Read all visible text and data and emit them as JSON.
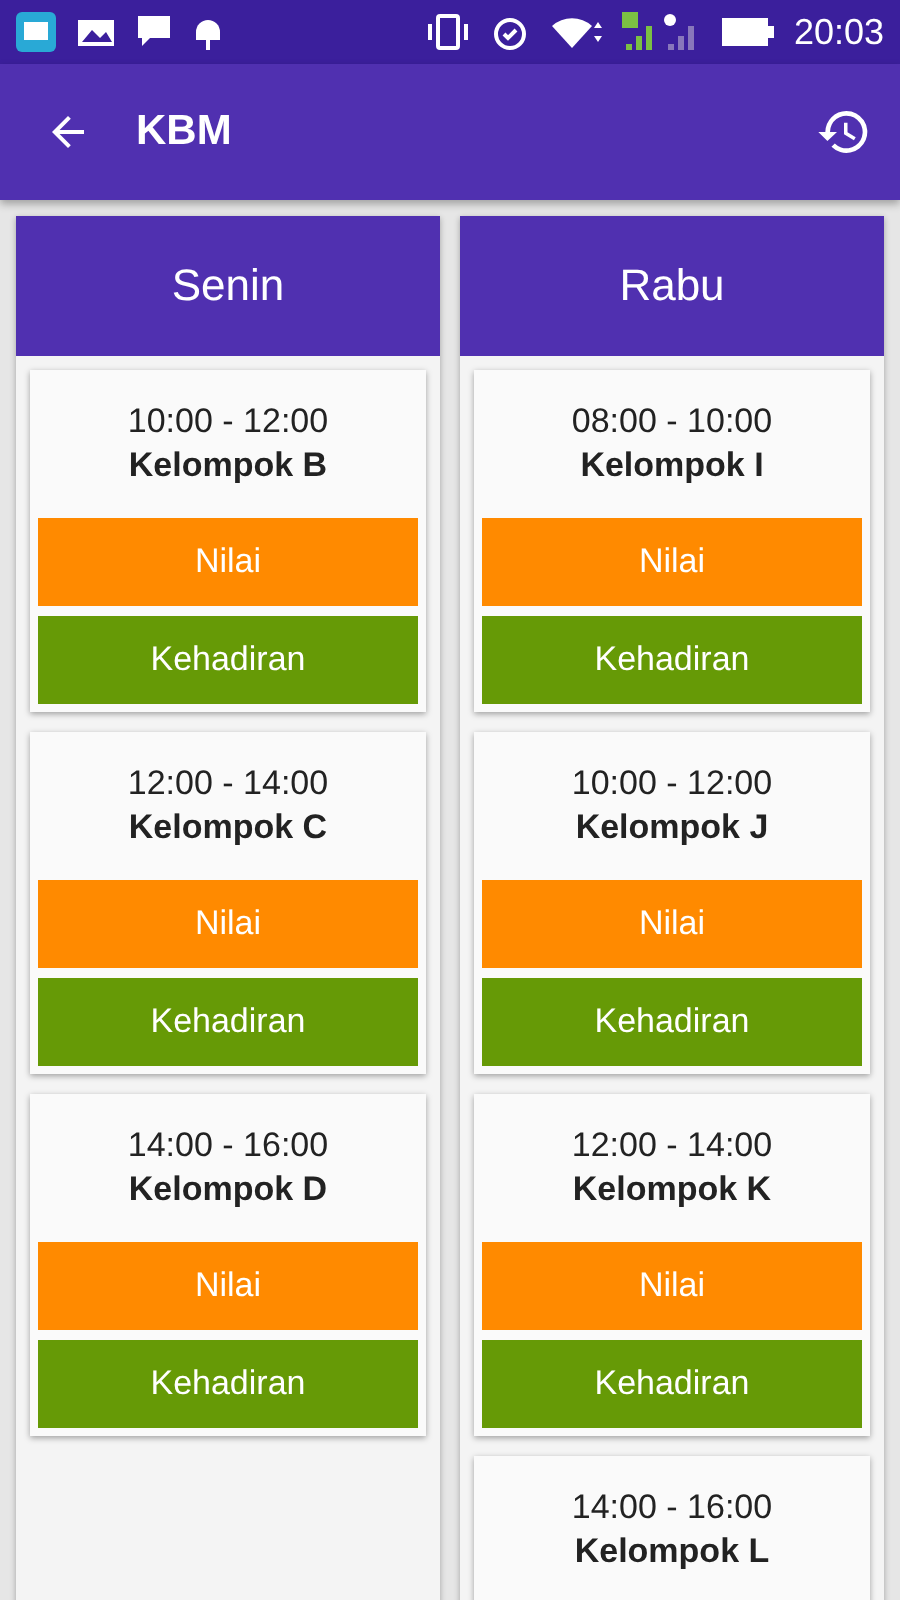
{
  "status_bar": {
    "time": "20:03"
  },
  "app_bar": {
    "title": "KBM"
  },
  "days": [
    {
      "name": "Senin",
      "sessions": [
        {
          "time": "10:00 - 12:00",
          "group": "Kelompok B",
          "buttons": [
            {
              "kind": "grade",
              "label": "Nilai"
            },
            {
              "kind": "attendance",
              "label": "Kehadiran"
            }
          ]
        },
        {
          "time": "12:00 - 14:00",
          "group": "Kelompok C",
          "buttons": [
            {
              "kind": "grade",
              "label": "Nilai"
            },
            {
              "kind": "attendance",
              "label": "Kehadiran"
            }
          ]
        },
        {
          "time": "14:00 - 16:00",
          "group": "Kelompok D",
          "buttons": [
            {
              "kind": "grade",
              "label": "Nilai"
            },
            {
              "kind": "attendance",
              "label": "Kehadiran"
            }
          ]
        }
      ]
    },
    {
      "name": "Rabu",
      "sessions": [
        {
          "time": "08:00 - 10:00",
          "group": "Kelompok I",
          "buttons": [
            {
              "kind": "grade",
              "label": "Nilai"
            },
            {
              "kind": "attendance",
              "label": "Kehadiran"
            }
          ]
        },
        {
          "time": "10:00 - 12:00",
          "group": "Kelompok J",
          "buttons": [
            {
              "kind": "grade",
              "label": "Nilai"
            },
            {
              "kind": "attendance",
              "label": "Kehadiran"
            }
          ]
        },
        {
          "time": "12:00 - 14:00",
          "group": "Kelompok K",
          "buttons": [
            {
              "kind": "grade",
              "label": "Nilai"
            },
            {
              "kind": "attendance",
              "label": "Kehadiran"
            }
          ]
        },
        {
          "time": "14:00 - 16:00",
          "group": "Kelompok L"
        }
      ]
    }
  ]
}
